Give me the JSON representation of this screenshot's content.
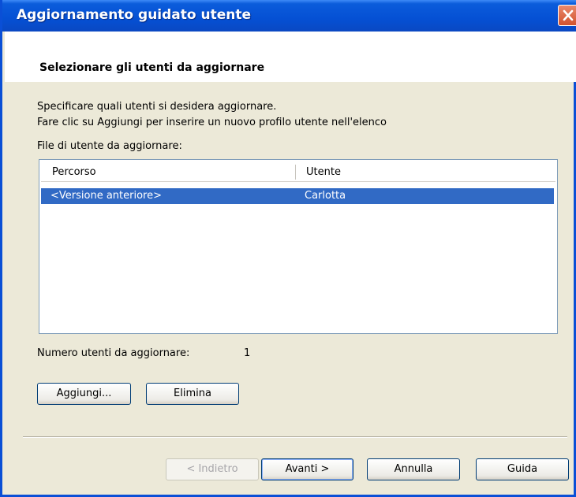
{
  "window": {
    "title": "Aggiornamento guidato utente"
  },
  "header": {
    "heading": "Selezionare gli utenti da aggiornare"
  },
  "body": {
    "instruction_line1": "Specificare quali utenti si desidera aggiornare.",
    "instruction_line2": "Fare clic su Aggiungi per inserire un nuovo profilo utente nell'elenco",
    "list_label": "File di utente da aggiornare:",
    "columns": [
      "Percorso",
      "Utente"
    ],
    "rows": [
      {
        "path": "<Versione anteriore>",
        "user": "Carlotta",
        "selected": true
      }
    ],
    "count_label": "Numero utenti da aggiornare:",
    "count_value": "1"
  },
  "buttons": {
    "add": "Aggiungi...",
    "remove": "Elimina",
    "back": "< Indietro",
    "next": "Avanti >",
    "cancel": "Annulla",
    "help": "Guida"
  },
  "colors": {
    "titlebar": "#0550d4",
    "selection": "#316ac5",
    "dialog_bg": "#ece9d8",
    "close_button": "#d2522d"
  }
}
